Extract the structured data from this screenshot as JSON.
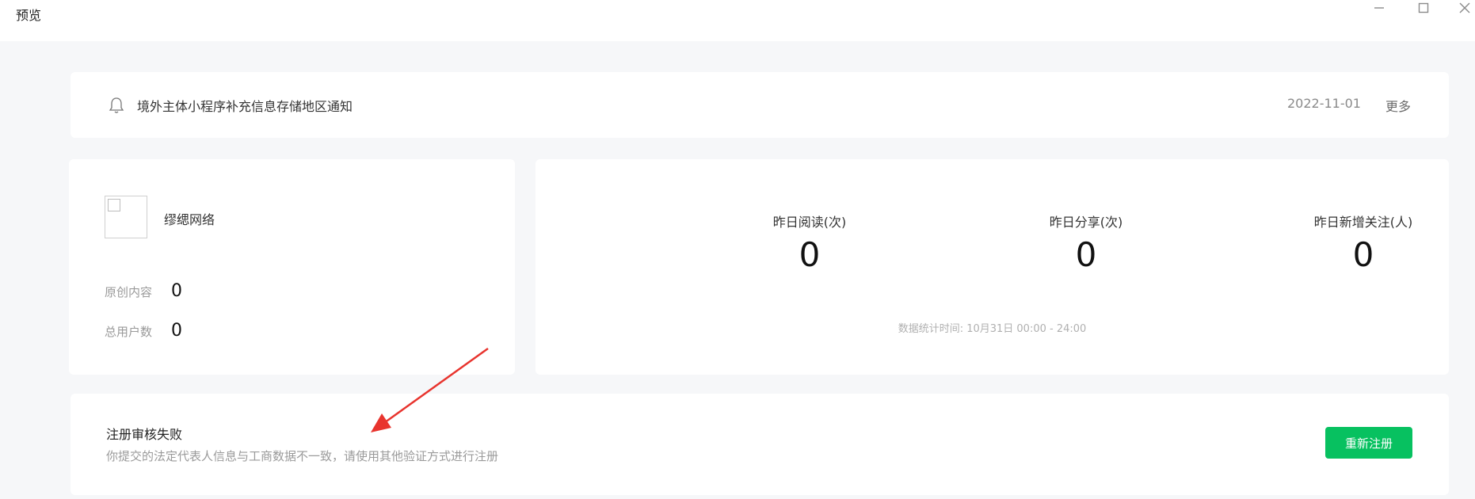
{
  "window": {
    "title": "预览",
    "controls": [
      "minimize-icon",
      "maximize-icon",
      "close-icon"
    ]
  },
  "notice": {
    "icon": "bell-icon",
    "text": "境外主体小程序补充信息存储地区通知",
    "date": "2022-11-01",
    "more_label": "更多"
  },
  "account": {
    "name": "缪缌网络",
    "stats": [
      {
        "label": "原创内容",
        "value": "0"
      },
      {
        "label": "总用户数",
        "value": "0"
      }
    ]
  },
  "metrics": {
    "items": [
      {
        "label": "昨日阅读(次)",
        "value": "0"
      },
      {
        "label": "昨日分享(次)",
        "value": "0"
      },
      {
        "label": "昨日新增关注(人)",
        "value": "0"
      }
    ],
    "footnote": "数据统计时间: 10月31日 00:00 - 24:00"
  },
  "registration": {
    "title": "注册审核失败",
    "description": "你提交的法定代表人信息与工商数据不一致，请使用其他验证方式进行注册",
    "button_label": "重新注册"
  },
  "colors": {
    "background": "#f6f7f9",
    "card": "#ffffff",
    "accent": "#07c160",
    "annotation_arrow": "#e8342e"
  }
}
